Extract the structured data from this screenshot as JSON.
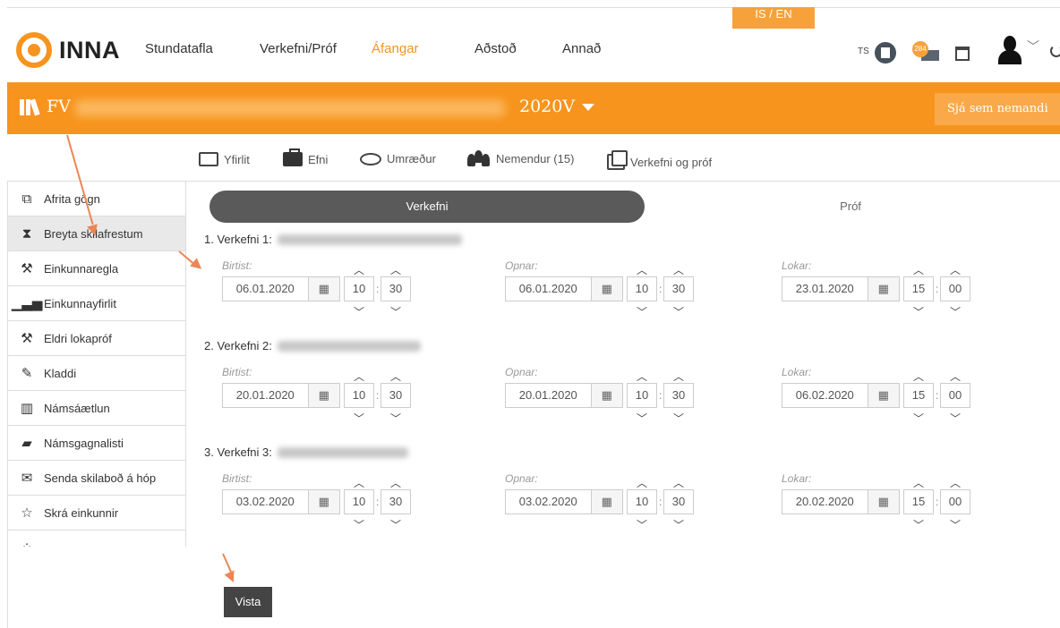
{
  "header": {
    "lang_toggle": "IS / EN",
    "logo_text": "INNA",
    "nav": [
      {
        "label": "Stundatafla",
        "active": false
      },
      {
        "label": "Verkefni/Próf",
        "active": false
      },
      {
        "label": "Áfangar",
        "active": true
      },
      {
        "label": "Aðstoð",
        "active": false
      },
      {
        "label": "Annað",
        "active": false
      }
    ],
    "user_initials": "TS",
    "message_count": "284"
  },
  "course_bar": {
    "prefix": "FV",
    "term": "2020V",
    "view_as_student": "Sjá sem nemandi"
  },
  "subtabs": [
    {
      "label": "Yfirlit",
      "icon": "folder-icon"
    },
    {
      "label": "Efni",
      "icon": "briefcase-icon"
    },
    {
      "label": "Umræður",
      "icon": "chat-icon"
    },
    {
      "label": "Nemendur (15)",
      "icon": "people-icon"
    },
    {
      "label": "Verkefni og próf",
      "icon": "copy-icon"
    }
  ],
  "sidebar": [
    {
      "label": "Afrita gögn",
      "icon": "copy-icon",
      "active": false
    },
    {
      "label": "Breyta skilafrestum",
      "icon": "hourglass-icon",
      "active": true
    },
    {
      "label": "Einkunnaregla",
      "icon": "gavel-icon",
      "active": false
    },
    {
      "label": "Einkunnayfirlit",
      "icon": "signal-bars-icon",
      "active": false
    },
    {
      "label": "Eldri lokapróf",
      "icon": "gavel-icon",
      "active": false
    },
    {
      "label": "Kladdi",
      "icon": "edit-icon",
      "active": false
    },
    {
      "label": "Námsáætlun",
      "icon": "map-icon",
      "active": false
    },
    {
      "label": "Námsgagnalisti",
      "icon": "book-icon",
      "active": false
    },
    {
      "label": "Senda skilaboð á hóp",
      "icon": "envelope-icon",
      "active": false
    },
    {
      "label": "Skrá einkunnir",
      "icon": "star-icon",
      "active": false
    }
  ],
  "segment": {
    "left": "Verkefni",
    "right": "Próf"
  },
  "tasks": [
    {
      "title": "1. Verkefni 1:",
      "birtist": {
        "label": "Birtist:",
        "date": "06.01.2020",
        "hour": "10",
        "minute": "30"
      },
      "opnar": {
        "label": "Opnar:",
        "date": "06.01.2020",
        "hour": "10",
        "minute": "30"
      },
      "lokar": {
        "label": "Lokar:",
        "date": "23.01.2020",
        "hour": "15",
        "minute": "00"
      }
    },
    {
      "title": "2. Verkefni 2:",
      "birtist": {
        "label": "Birtist:",
        "date": "20.01.2020",
        "hour": "10",
        "minute": "30"
      },
      "opnar": {
        "label": "Opnar:",
        "date": "20.01.2020",
        "hour": "10",
        "minute": "30"
      },
      "lokar": {
        "label": "Lokar:",
        "date": "06.02.2020",
        "hour": "15",
        "minute": "00"
      }
    },
    {
      "title": "3. Verkefni 3:",
      "birtist": {
        "label": "Birtist:",
        "date": "03.02.2020",
        "hour": "10",
        "minute": "30"
      },
      "opnar": {
        "label": "Opnar:",
        "date": "03.02.2020",
        "hour": "10",
        "minute": "30"
      },
      "lokar": {
        "label": "Lokar:",
        "date": "20.02.2020",
        "hour": "15",
        "minute": "00"
      }
    }
  ],
  "save_label": "Vista",
  "colors": {
    "brand_orange": "#f7941d",
    "arrow": "#ec8654",
    "dark_button": "#444444"
  }
}
